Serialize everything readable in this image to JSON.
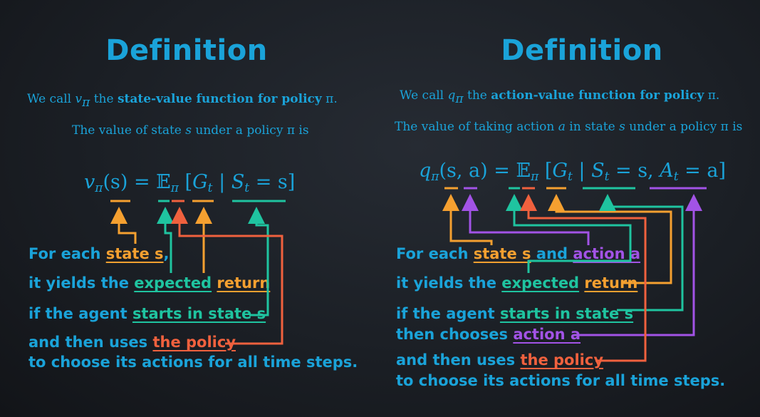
{
  "left": {
    "title": "Definition",
    "intro_pre": "We call ",
    "intro_sym": "v",
    "intro_sub": "π",
    "intro_mid": " the ",
    "intro_bold": "state-value function for policy",
    "intro_end": " π.",
    "line2_pre": "The value of state ",
    "line2_var": "s",
    "line2_end": " under a policy π is",
    "equation": {
      "lhs_fn": "v",
      "lhs_sub": "π",
      "lhs_args": "(s) = ",
      "expect": "𝔼",
      "expect_sub": "π",
      "bracket_open": " [",
      "g": "G",
      "g_sub": "t",
      "bar": " | ",
      "s": "S",
      "s_sub": "t",
      "cond": " = s]"
    },
    "lines": [
      {
        "pre": "For each ",
        "hl": "state s",
        "post": ","
      },
      {
        "pre": "it yields the ",
        "hl1": "expected",
        "mid": " ",
        "hl2": "return"
      },
      {
        "pre": "if the agent ",
        "hl": "starts in state s"
      },
      {
        "pre": "and then uses ",
        "hl": "the policy"
      },
      {
        "pre": "to choose its actions for all time steps."
      }
    ]
  },
  "right": {
    "title": "Definition",
    "intro_pre": "We call ",
    "intro_sym": "q",
    "intro_sub": "π",
    "intro_mid": " the ",
    "intro_bold": "action-value function for policy",
    "intro_end": " π.",
    "line2_pre": "The value of taking action ",
    "line2_var1": "a",
    "line2_mid": " in state ",
    "line2_var2": "s",
    "line2_end": " under a policy π is",
    "equation": {
      "lhs_fn": "q",
      "lhs_sub": "π",
      "lhs_args": "(s, a) = ",
      "expect": "𝔼",
      "expect_sub": "π",
      "bracket_open": " [",
      "g": "G",
      "g_sub": "t",
      "bar": " | ",
      "s": "S",
      "s_sub": "t",
      "cond1": " = s, ",
      "a": "A",
      "a_sub": "t",
      "cond2": " = a]"
    },
    "lines": [
      {
        "pre": "For each ",
        "hl1": "state s",
        "mid": " and ",
        "hl2": "action a"
      },
      {
        "pre": "it yields the ",
        "hl1": "expected",
        "mid": " ",
        "hl2": "return"
      },
      {
        "pre": "if the agent ",
        "hl": "starts in state s"
      },
      {
        "pre": "then chooses ",
        "hl": "action a"
      },
      {
        "pre": "and then uses ",
        "hl": "the policy"
      },
      {
        "pre": "to choose its actions for all time steps."
      }
    ]
  },
  "colors": {
    "text": "#1aa3d9",
    "state": "#f5a030",
    "expected": "#1fc4a0",
    "policy": "#f0613e",
    "action": "#a253e6",
    "background": "#1b1f25"
  }
}
